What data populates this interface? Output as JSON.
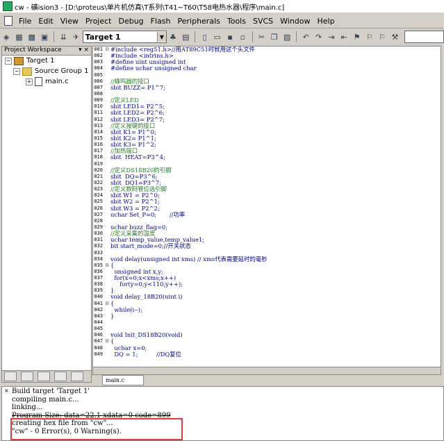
{
  "window": {
    "title": "cw  - 礦ision3 - [D:\\proteus\\单片机仿真\\T系列\\T41~T60\\T58电热水器\\程序\\main.c]"
  },
  "menu": [
    "File",
    "Edit",
    "View",
    "Project",
    "Debug",
    "Flash",
    "Peripherals",
    "Tools",
    "SVCS",
    "Window",
    "Help"
  ],
  "toolbar": {
    "target": "Target 1"
  },
  "workspace": {
    "header": "Project Workspace",
    "header_controls": "▾ ×",
    "tree": [
      {
        "label": "Target 1",
        "indent": 0,
        "toggle": "−",
        "icon": "target"
      },
      {
        "label": "Source Group 1",
        "indent": 1,
        "toggle": "−",
        "icon": "folder"
      },
      {
        "label": "main.c",
        "indent": 2,
        "toggle": "+",
        "icon": "file"
      }
    ]
  },
  "editor": {
    "tab": "main.c",
    "lines": [
      {
        "n": "001",
        "f": "⊟",
        "t": "#include <reg51.h>//用AT89C51时就用这个头文件"
      },
      {
        "n": "002",
        "f": "",
        "t": "#include <intrins.h>"
      },
      {
        "n": "003",
        "f": "",
        "t": "#define uint unsigned int"
      },
      {
        "n": "004",
        "f": "",
        "t": "#define uchar unsigned char"
      },
      {
        "n": "005",
        "f": "",
        "t": ""
      },
      {
        "n": "006",
        "f": "",
        "t": "//蜂鸣器的接口",
        "c": true
      },
      {
        "n": "007",
        "f": "",
        "t": "sbit BUZZ= P1^7;"
      },
      {
        "n": "008",
        "f": "",
        "t": ""
      },
      {
        "n": "009",
        "f": "",
        "t": "//定义LED",
        "c": true
      },
      {
        "n": "010",
        "f": "",
        "t": "sbit LED1= P2^5;"
      },
      {
        "n": "011",
        "f": "",
        "t": "sbit LED2= P2^6;"
      },
      {
        "n": "012",
        "f": "",
        "t": "sbit LED3= P2^7;"
      },
      {
        "n": "013",
        "f": "",
        "t": "//定义按键的接口",
        "c": true
      },
      {
        "n": "014",
        "f": "",
        "t": "sbit K1= P1^0;"
      },
      {
        "n": "015",
        "f": "",
        "t": "sbit K2= P1^1;"
      },
      {
        "n": "016",
        "f": "",
        "t": "sbit K3= P1^2;"
      },
      {
        "n": "017",
        "f": "",
        "t": "//加热端口",
        "c": true
      },
      {
        "n": "018",
        "f": "",
        "t": "sbit  HEAT=P3^4;"
      },
      {
        "n": "019",
        "f": "",
        "t": ""
      },
      {
        "n": "020",
        "f": "",
        "t": "//定义DS18B20的引脚",
        "c": true
      },
      {
        "n": "021",
        "f": "",
        "t": "sbit  DQ=P3^6;"
      },
      {
        "n": "022",
        "f": "",
        "t": "sbit  DQ1=P3^7;"
      },
      {
        "n": "023",
        "f": "",
        "t": "//定义数码管位选引脚",
        "c": true
      },
      {
        "n": "024",
        "f": "",
        "t": "sbit W1 = P2^0;"
      },
      {
        "n": "025",
        "f": "",
        "t": "sbit W2 = P2^1;"
      },
      {
        "n": "026",
        "f": "",
        "t": "sbit W3 = P2^2;"
      },
      {
        "n": "027",
        "f": "",
        "t": "uchar Set_P=0;       //功率"
      },
      {
        "n": "028",
        "f": "",
        "t": ""
      },
      {
        "n": "029",
        "f": "",
        "t": "uchar buzz_flag=0;"
      },
      {
        "n": "030",
        "f": "",
        "t": "//定义采集的温度",
        "c": true
      },
      {
        "n": "031",
        "f": "",
        "t": "uchar temp_value,temp_value1;"
      },
      {
        "n": "032",
        "f": "",
        "t": "bit start_mode=0;//开关状态"
      },
      {
        "n": "033",
        "f": "",
        "t": ""
      },
      {
        "n": "034",
        "f": "",
        "t": "void delay(unsigned int xms) // xms代表需要延时的毫秒"
      },
      {
        "n": "035",
        "f": "⊟",
        "t": "{"
      },
      {
        "n": "036",
        "f": "",
        "t": "  unsigned int x,y;"
      },
      {
        "n": "037",
        "f": "",
        "t": "  for(x=0;x<xms;x++)"
      },
      {
        "n": "038",
        "f": "",
        "t": "     for(y=0;y<110;y++);"
      },
      {
        "n": "039",
        "f": "",
        "t": "}"
      },
      {
        "n": "040",
        "f": "",
        "t": "void delay_18B20(uint i)"
      },
      {
        "n": "041",
        "f": "⊟",
        "t": "{"
      },
      {
        "n": "042",
        "f": "",
        "t": "  while(i--);"
      },
      {
        "n": "043",
        "f": "",
        "t": "}"
      },
      {
        "n": "044",
        "f": "",
        "t": ""
      },
      {
        "n": "045",
        "f": "",
        "t": ""
      },
      {
        "n": "046",
        "f": "",
        "t": "void Init_DS18B20(void)"
      },
      {
        "n": "047",
        "f": "⊟",
        "t": "{"
      },
      {
        "n": "048",
        "f": "",
        "t": "  uchar x=0;"
      },
      {
        "n": "049",
        "f": "",
        "t": "  DQ = 1;          //DQ复位"
      }
    ]
  },
  "output": {
    "lines": [
      "Build target 'Target 1'",
      "compiling main.c...",
      "linking...",
      "Program Size: data=22.1 xdata=0 code=899",
      "creating hex file from \"cw\"...",
      "\"cw\" - 0 Error(s), 0 Warning(s)."
    ]
  },
  "colors": {
    "highlight": "#e23a3a",
    "code": "#00008b",
    "comment": "#2a7a2a"
  }
}
